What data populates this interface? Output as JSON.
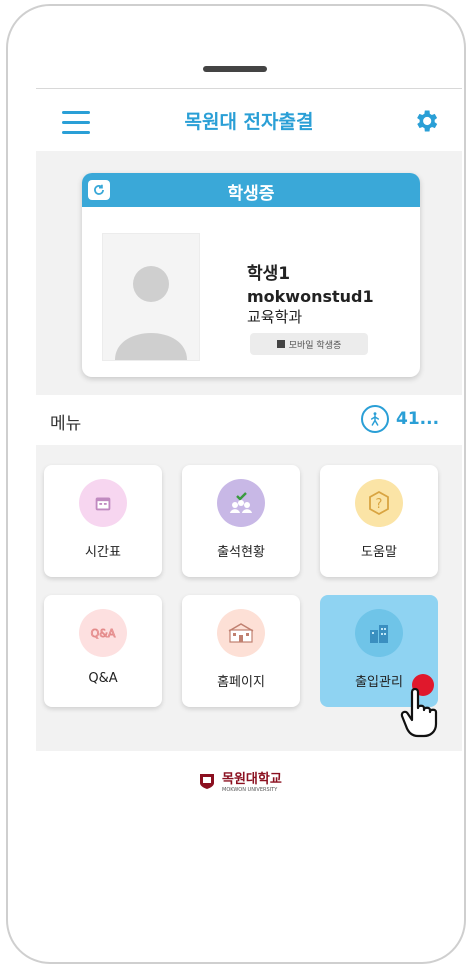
{
  "header": {
    "title": "목원대 전자출결"
  },
  "id_card": {
    "title": "학생증",
    "name": "학생1",
    "student_id": "mokwonstud1",
    "department": "교육학과",
    "mobile_button_label": "모바일 학생증"
  },
  "menu": {
    "label": "메뉴",
    "count": "41..."
  },
  "tiles": [
    {
      "label": "시간표",
      "icon": "calendar-icon",
      "color": "#f7d6f0"
    },
    {
      "label": "출석현황",
      "icon": "attendance-icon",
      "color": "#c8b8e6"
    },
    {
      "label": "도움말",
      "icon": "help-icon",
      "color": "#fbe4a6"
    },
    {
      "label": "Q&A",
      "icon": "qna-icon",
      "color": "#fde0e0"
    },
    {
      "label": "홈페이지",
      "icon": "school-building-icon",
      "color": "#fde0d6"
    },
    {
      "label": "출입관리",
      "icon": "building-icon",
      "color": "#6fc4e8"
    }
  ],
  "footer": {
    "logo_text": "목원대학교",
    "logo_sub": "MOKWON UNIVERSITY"
  },
  "colors": {
    "accent": "#2a9fd6",
    "card_header": "#3aa8d8",
    "notification": "#e0182c"
  }
}
